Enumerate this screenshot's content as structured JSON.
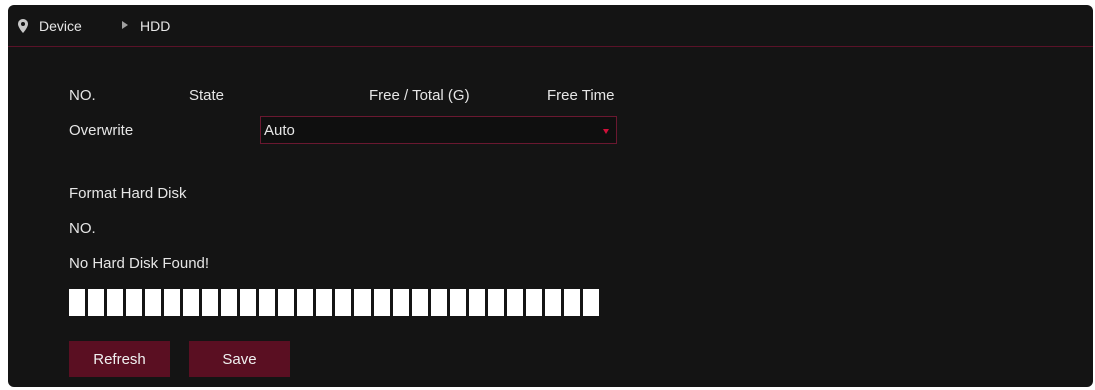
{
  "breadcrumb": {
    "device": "Device",
    "current": "HDD"
  },
  "table": {
    "headers": [
      "NO.",
      "State",
      "Free / Total (G)",
      "Free Time"
    ]
  },
  "overwrite": {
    "label": "Overwrite",
    "value": "Auto"
  },
  "format": {
    "heading": "Format Hard Disk",
    "no_label": "NO.",
    "message": "No Hard Disk Found!",
    "disk_segments": 28
  },
  "buttons": {
    "refresh": "Refresh",
    "save": "Save"
  },
  "icons": {
    "location": "map-pin-icon",
    "separator": "triangle-right-icon",
    "dropdown": "caret-down-icon"
  },
  "colors": {
    "accent": "#5a0f22",
    "background": "#141414",
    "border": "#6a1830",
    "caret": "#d0103a"
  }
}
